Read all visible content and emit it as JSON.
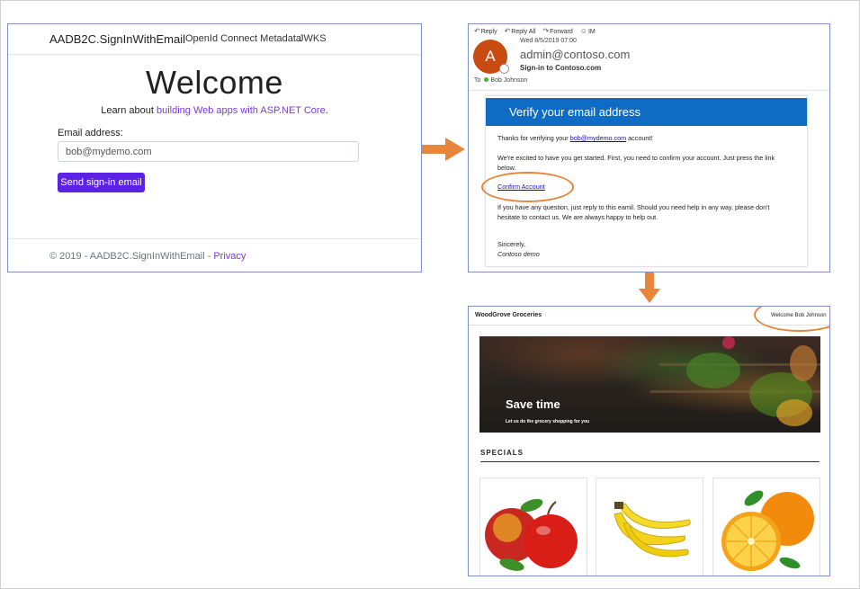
{
  "signin_page": {
    "brand": "AADB2C.SignInWithEmail",
    "nav_links": [
      "OpenId Connect Metadata",
      "JWKS"
    ],
    "heading": "Welcome",
    "learn_prefix": "Learn about ",
    "learn_link": "building Web apps with ASP.NET Core",
    "learn_suffix": ".",
    "email_label": "Email address:",
    "email_value": "bob@mydemo.com",
    "send_button": "Send sign-in email",
    "footer_text": "© 2019 - AADB2C.SignInWithEmail - ",
    "footer_link": "Privacy",
    "accent_color": "#5b22e6"
  },
  "email": {
    "toolbar": [
      {
        "icon": "reply-icon",
        "label": "Reply"
      },
      {
        "icon": "reply-all-icon",
        "label": "Reply All"
      },
      {
        "icon": "forward-icon",
        "label": "Forward"
      },
      {
        "icon": "im-icon",
        "label": "IM"
      }
    ],
    "avatar_letter": "A",
    "date": "Wed 8/5/2019 07:00",
    "from": "admin@contoso.com",
    "subject": "Sign-in to Contoso.com",
    "to_label": "To",
    "to_name": "Bob Johnson",
    "banner": "Verify your email address",
    "thanks_prefix": "Thanks for verifying your ",
    "thanks_email": "bob@mydemo.com",
    "thanks_suffix": " account!",
    "para_excited": "We're excited to have you get started. First, you need to confirm your account. Just press the link below.",
    "confirm_link": "Confirm Account",
    "para_help": "If you have any question, just reply to this eamil. Should you need help in any way, please don't hesitate to contact us. We are always happy to help out.",
    "sincerely": "Sincerely,",
    "signature": "Contoso demo",
    "banner_color": "#0e6cc4"
  },
  "woodgrove": {
    "brand": "WoodGrove Groceries",
    "welcome": "Welcome Bob Johnson",
    "hero_title": "Save time",
    "hero_subtitle": "Let us do the grocery shopping for you",
    "specials_heading": "SPECIALS",
    "products": [
      {
        "name": "apples-image"
      },
      {
        "name": "bananas-image"
      },
      {
        "name": "oranges-image"
      }
    ]
  },
  "highlight_color": "#e8853d"
}
